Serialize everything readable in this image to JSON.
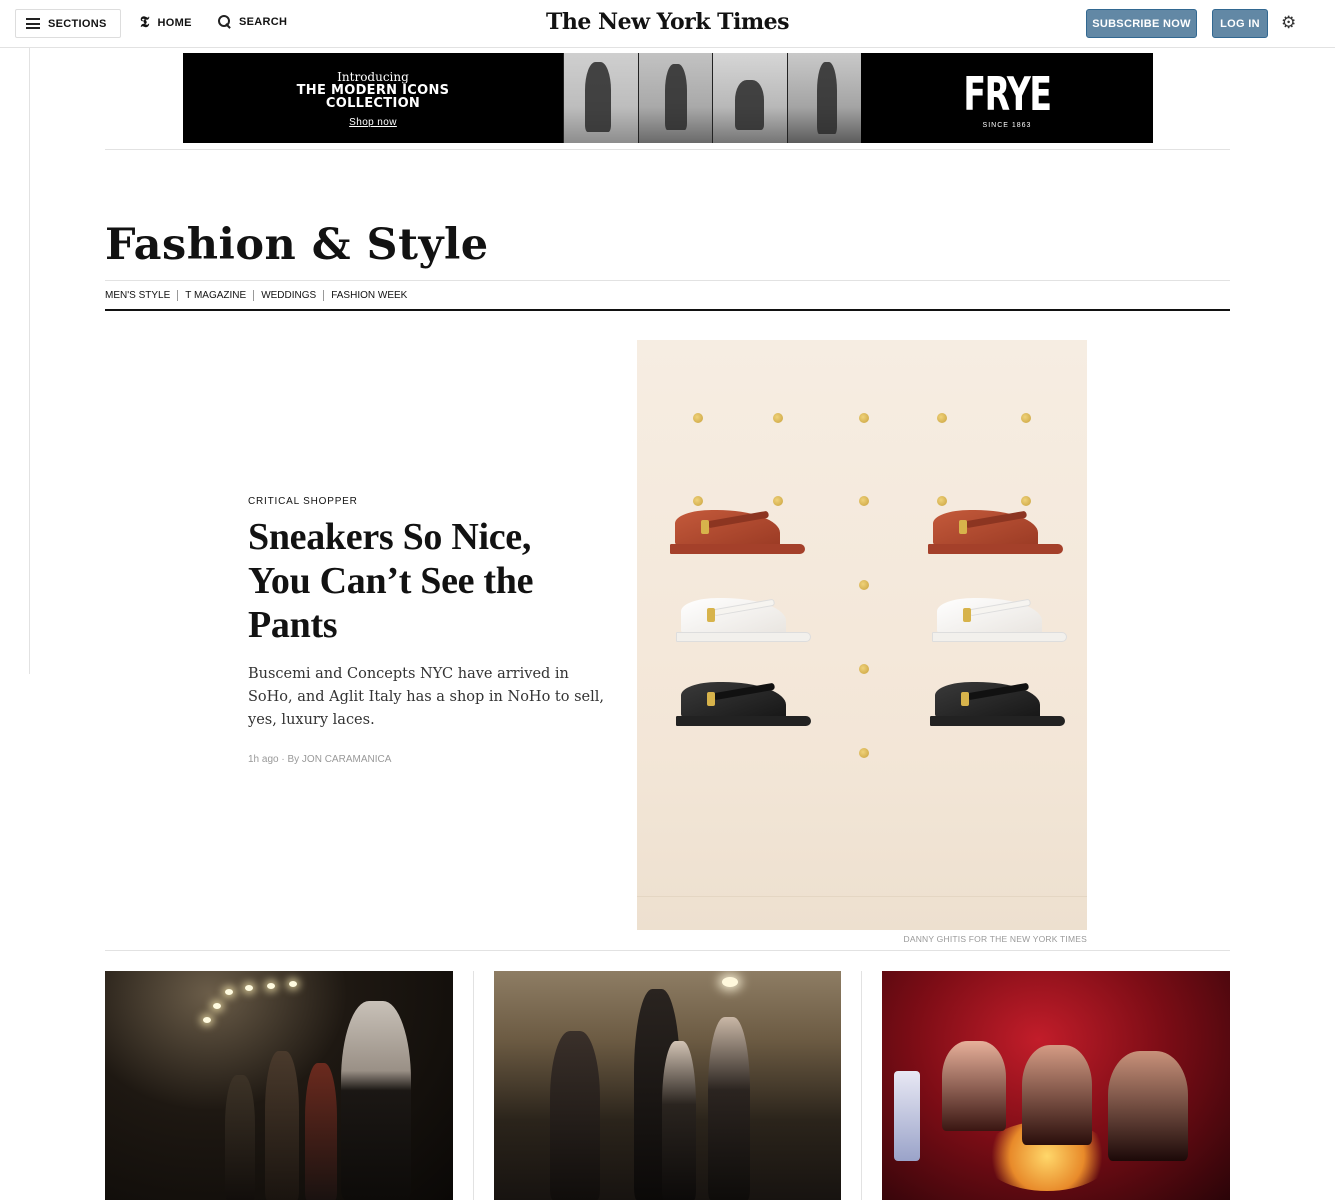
{
  "masthead": {
    "sections_label": "SECTIONS",
    "home_label": "HOME",
    "search_label": "SEARCH",
    "logo_text": "The New York Times",
    "subscribe_label": "SUBSCRIBE NOW",
    "login_label": "LOG IN",
    "home_icon": "t-logo-icon",
    "settings_icon": "gear-icon"
  },
  "ad": {
    "intro": "Introducing",
    "headline_line1": "THE MODERN ICONS",
    "headline_line2": "COLLECTION",
    "cta": "Shop now",
    "brand": "FRYE",
    "since": "SINCE 1863"
  },
  "section": {
    "title": "Fashion & Style",
    "subnav": [
      "MEN'S STYLE",
      "T MAGAZINE",
      "WEDDINGS",
      "FASHION WEEK"
    ]
  },
  "lead": {
    "kicker": "CRITICAL SHOPPER",
    "headline": "Sneakers So Nice, You Can’t See the Pants",
    "summary": "Buscemi and Concepts NYC have arrived in SoHo, and Aglit Italy has a shop in NoHo to sell, yes, luxury laces.",
    "byline": "1h ago · By JON CARAMANICA",
    "credit": "DANNY GHITIS FOR THE NEW YORK TIMES"
  },
  "colors": {
    "accent_button": "#6288a5",
    "rule": "#e2e2e2",
    "text": "#121212"
  }
}
